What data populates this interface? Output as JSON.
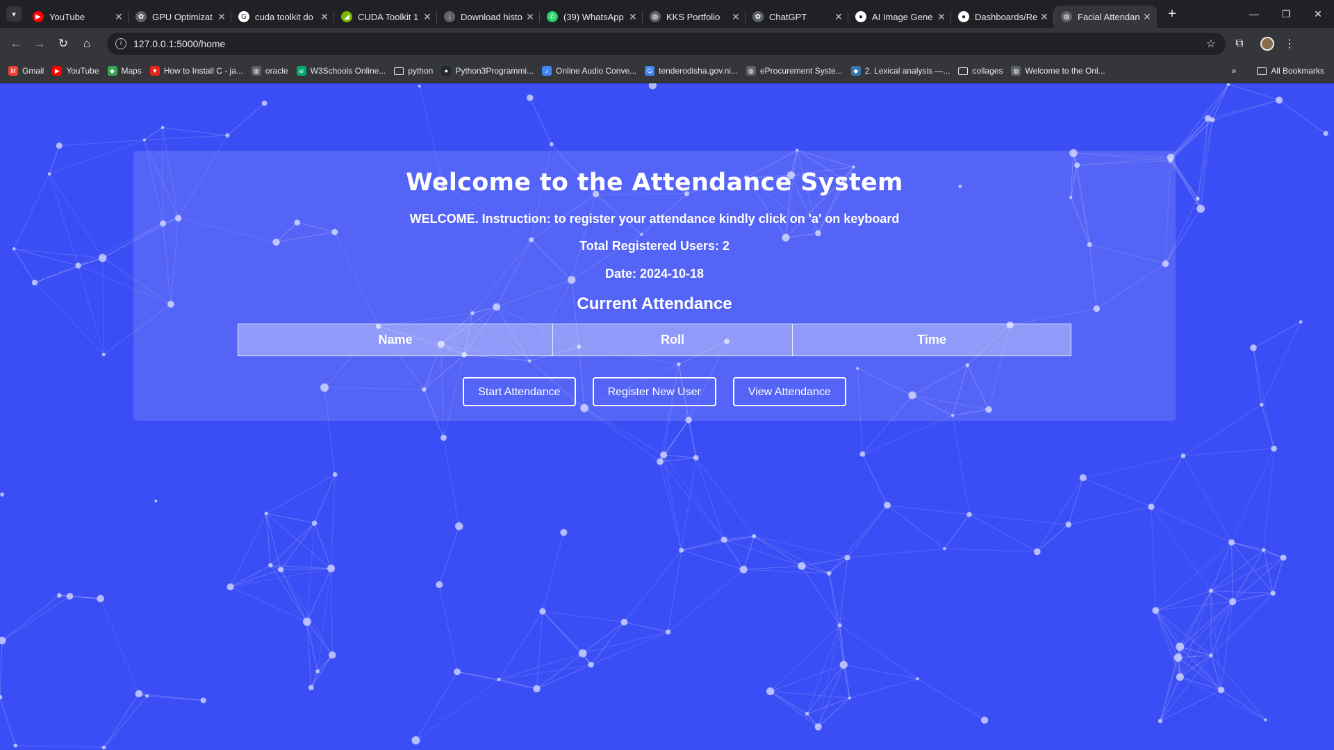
{
  "browser": {
    "tabs": [
      {
        "title": "YouTube",
        "icon": "youtube-icon",
        "color": "#ff0000",
        "active": false
      },
      {
        "title": "GPU Optimizat",
        "icon": "chatgpt-icon",
        "color": "#5f6368",
        "active": false
      },
      {
        "title": "cuda toolkit do",
        "icon": "google-icon",
        "color": "#ffffff",
        "active": false
      },
      {
        "title": "CUDA Toolkit 1",
        "icon": "nvidia-icon",
        "color": "#76b900",
        "active": false
      },
      {
        "title": "Download histo",
        "icon": "download-icon",
        "color": "#5f6368",
        "active": false
      },
      {
        "title": "(39) WhatsApp",
        "icon": "whatsapp-icon",
        "color": "#25d366",
        "active": false
      },
      {
        "title": "KKS Portfolio",
        "icon": "globe-icon",
        "color": "#5f6368",
        "active": false
      },
      {
        "title": "ChatGPT",
        "icon": "chatgpt-icon",
        "color": "#5f6368",
        "active": false
      },
      {
        "title": "AI Image Gene",
        "icon": "ai-icon",
        "color": "#ffffff",
        "active": false
      },
      {
        "title": "Dashboards/Re",
        "icon": "github-icon",
        "color": "#ffffff",
        "active": false
      },
      {
        "title": "Facial Attendan",
        "icon": "globe-icon",
        "color": "#5f6368",
        "active": true
      }
    ],
    "url": "127.0.0.1:5000/home",
    "bookmarks": [
      {
        "label": "Gmail",
        "icon": "gmail-icon",
        "color": "#ea4335"
      },
      {
        "label": "YouTube",
        "icon": "youtube-icon",
        "color": "#ff0000"
      },
      {
        "label": "Maps",
        "icon": "maps-icon",
        "color": "#34a853"
      },
      {
        "label": "How to Install C - ja...",
        "icon": "bookmark-icon",
        "color": "#e2231a"
      },
      {
        "label": "oracle",
        "icon": "globe-icon",
        "color": "#5f6368"
      },
      {
        "label": "W3Schools Online...",
        "icon": "w3schools-icon",
        "color": "#04aa6d"
      },
      {
        "label": "python",
        "icon": "folder-icon",
        "color": ""
      },
      {
        "label": "Python3Programmi...",
        "icon": "github-icon",
        "color": "#24292e"
      },
      {
        "label": "Online Audio Conve...",
        "icon": "audio-icon",
        "color": "#4285f4"
      },
      {
        "label": "tenderodisha.gov.ni...",
        "icon": "google-icon",
        "color": "#4285f4"
      },
      {
        "label": "eProcurement Syste...",
        "icon": "globe-icon",
        "color": "#5f6368"
      },
      {
        "label": "2. Lexical analysis —...",
        "icon": "python-icon",
        "color": "#3776ab"
      },
      {
        "label": "collages",
        "icon": "folder-icon",
        "color": ""
      },
      {
        "label": "Welcome to the Onl...",
        "icon": "globe-icon",
        "color": "#5f6368"
      }
    ],
    "all_bookmarks": "All Bookmarks"
  },
  "page": {
    "title": "Welcome to the Attendance System",
    "instruction": "WELCOME. Instruction: to register your attendance kindly click on 'a' on keyboard",
    "total_users": "Total Registered Users: 2",
    "date": "Date: 2024-10-18",
    "section_title": "Current Attendance",
    "table_headers": [
      "Name",
      "Roll",
      "Time"
    ],
    "buttons": {
      "start": "Start Attendance",
      "register": "Register New User",
      "view": "View Attendance"
    }
  },
  "colors": {
    "background": "#3b4ef5",
    "chrome_dark": "#202124",
    "chrome_light": "#35363a"
  }
}
